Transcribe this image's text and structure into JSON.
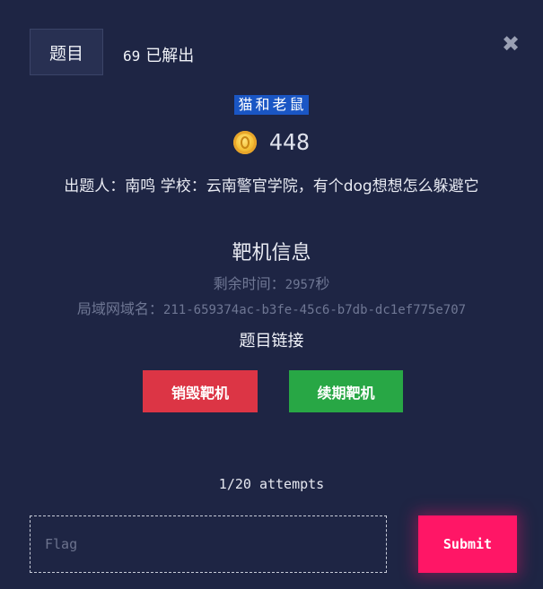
{
  "header": {
    "tab_label": "题目",
    "solve_count": "69",
    "solve_label": "已解出",
    "close_icon": "close-icon"
  },
  "challenge": {
    "name": "猫和老鼠",
    "points": "448",
    "points_icon": "coin-icon",
    "description": "出题人：南鸣 学校：云南警官学院，有个dog想想怎么躲避它"
  },
  "target": {
    "section_title": "靶机信息",
    "remaining_label": "剩余时间：",
    "remaining_value": "2957",
    "remaining_unit": "秒",
    "domain_label": "局域网域名：",
    "domain_value": "211-659374ac-b3fe-45c6-b7db-dc1ef775e707",
    "link_title": "题目链接",
    "destroy_label": "销毁靶机",
    "renew_label": "续期靶机"
  },
  "submission": {
    "attempts": "1/20 attempts",
    "flag_placeholder": "Flag",
    "flag_value": "",
    "submit_label": "Submit"
  },
  "colors": {
    "background": "#1e2544",
    "title_highlight": "#1a56c4",
    "destroy": "#dc3545",
    "renew": "#28a745",
    "submit": "#ff1666"
  }
}
